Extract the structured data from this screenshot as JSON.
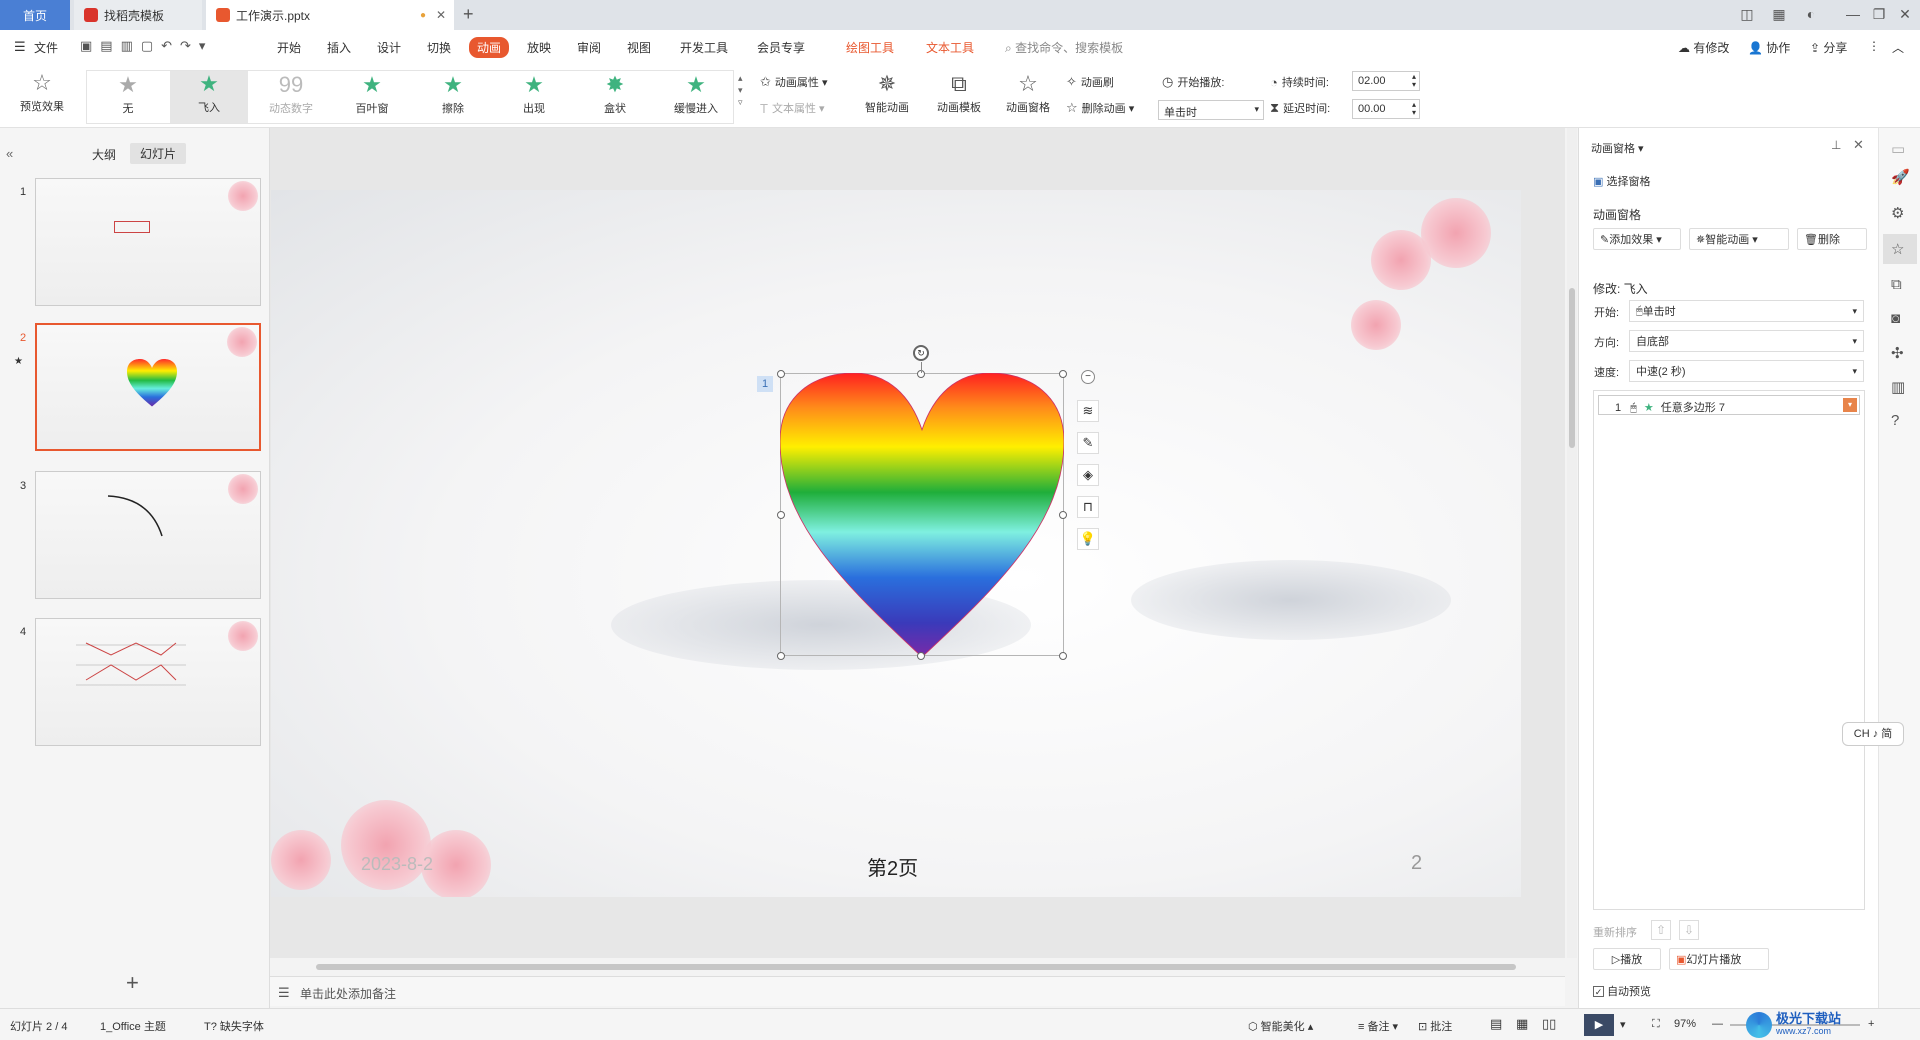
{
  "tabs": {
    "home": "首页",
    "template": "找稻壳模板",
    "doc": "工作演示.pptx"
  },
  "menu": {
    "file": "文件",
    "items": [
      "开始",
      "插入",
      "设计",
      "切换",
      "动画",
      "放映",
      "审阅",
      "视图",
      "开发工具",
      "会员专享"
    ],
    "drawing_tools": "绘图工具",
    "text_tools": "文本工具",
    "search": "查找命令、搜索模板",
    "right": [
      "有修改",
      "协作",
      "分享"
    ]
  },
  "ribbon": {
    "preview": "预览效果",
    "effects": [
      "无",
      "飞入",
      "动态数字",
      "百叶窗",
      "擦除",
      "出现",
      "盒状",
      "缓慢进入"
    ],
    "anim_props": "动画属性",
    "text_props": "文本属性",
    "smart_anim": "智能动画",
    "anim_template": "动画模板",
    "anim_pane": "动画窗格",
    "anim_brush": "动画刷",
    "delete_anim": "删除动画",
    "start_play": "开始播放:",
    "start_value": "单击时",
    "duration_label": "持续时间:",
    "duration_value": "02.00",
    "delay_label": "延迟时间:",
    "delay_value": "00.00"
  },
  "left": {
    "outline": "大纲",
    "slides": "幻灯片",
    "slide_numbers": [
      "1",
      "2",
      "3",
      "4"
    ],
    "add": "+"
  },
  "slide": {
    "seq_number": "1",
    "date": "2023-8-2",
    "footer": "第2页",
    "page_number": "2"
  },
  "notes": "单击此处添加备注",
  "pane": {
    "title": "动画窗格",
    "select_pane": "选择窗格",
    "section": "动画窗格",
    "add_effect": "添加效果",
    "smart_anim": "智能动画",
    "delete": "删除",
    "modify": "修改: 飞入",
    "start_label": "开始:",
    "start_value": "单击时",
    "direction_label": "方向:",
    "direction_value": "自底部",
    "speed_label": "速度:",
    "speed_value": "中速(2 秒)",
    "list_item": {
      "num": "1",
      "name": "任意多边形 7"
    },
    "reorder": "重新排序",
    "play": "播放",
    "slideshow": "幻灯片播放",
    "autopreview": "自动预览"
  },
  "ime": "CH ♪ 简",
  "status": {
    "slide": "幻灯片 2 / 4",
    "theme": "1_Office 主题",
    "missing_font": "缺失字体",
    "beautify": "智能美化",
    "notes": "备注",
    "comments": "批注",
    "zoom": "97%"
  },
  "watermark": "极光下载站",
  "watermark_url": "www.xz7.com",
  "colors": {
    "accent": "#e8582f",
    "selection": "#4a7fd4",
    "anim_green": "#3fb37f"
  }
}
